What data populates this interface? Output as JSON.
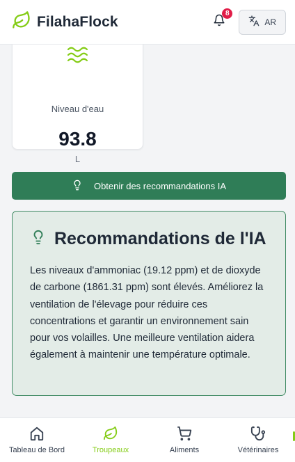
{
  "app": {
    "name": "FilahaFlock"
  },
  "header": {
    "notifications_count": "8",
    "language_label": "AR"
  },
  "metric_card": {
    "label": "Niveau d'eau",
    "value": "93.8",
    "unit": "L"
  },
  "ai_button": {
    "label": "Obtenir des recommandations IA"
  },
  "recommendations": {
    "title": "Recommandations de l'IA",
    "body": "Les niveaux d'ammoniac (19.12 ppm) et de dioxyde de carbone (1861.31 ppm) sont élevés. Améliorez la ventilation de l'élevage pour réduire ces concentrations et garantir un environnement sain pour vos volailles. Une meilleure ventilation aidera également à maintenir une température optimale."
  },
  "nav": {
    "items": [
      {
        "label": "Tableau de Bord",
        "icon": "home-icon",
        "active": false
      },
      {
        "label": "Troupeaux",
        "icon": "leaf-icon",
        "active": true
      },
      {
        "label": "Aliments",
        "icon": "cart-icon",
        "active": false
      },
      {
        "label": "Vétérinaires",
        "icon": "stethoscope-icon",
        "active": false
      }
    ]
  },
  "colors": {
    "brand_green": "#84cc16",
    "button_green": "#2f7d57",
    "badge_red": "#e11d48",
    "rec_bg": "#e3ece7"
  }
}
